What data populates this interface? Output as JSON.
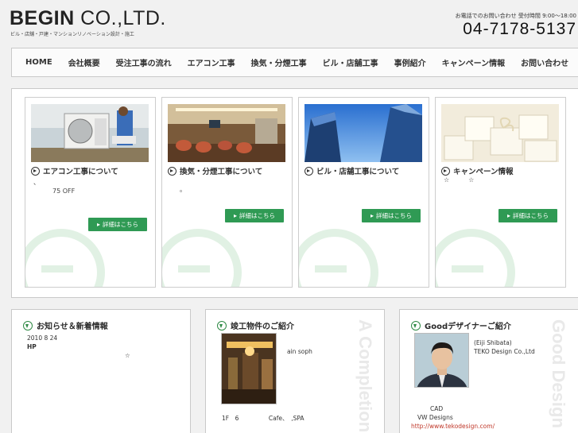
{
  "header": {
    "logo_bold": "BEGIN",
    "logo_rest": " CO.,LTD.",
    "tagline": "ビル・店舗・戸建・マンションリノベーション設計・施工",
    "tel_label": "お電話でのお問い合わせ 受付時間 9:00〜18:00",
    "tel": "04-7178-5137"
  },
  "nav": {
    "items": [
      "HOME",
      "会社概要",
      "受注工事の流れ",
      "エアコン工事",
      "換気・分煙工事",
      "ビル・店舗工事",
      "事例紹介",
      "キャンペーン情報",
      "お問い合わせ"
    ]
  },
  "cards": [
    {
      "title": "エアコン工事について",
      "text1": "、",
      "text2": "75 OFF",
      "button": "詳細はこちら"
    },
    {
      "title": "換気・分煙工事について",
      "text1": "。",
      "text2": "",
      "button": "詳細はこちら"
    },
    {
      "title": "ビル・店舗工事について",
      "text1": "",
      "text2": "",
      "button": "詳細はこちら"
    },
    {
      "title": "キャンペーン情報",
      "text1": "☆　　　☆",
      "text2": "",
      "button": "詳細はこちら"
    }
  ],
  "news": {
    "title": "お知らせ＆新着情報",
    "date": "2010 8 24",
    "hp": "HP",
    "star": "☆"
  },
  "completion": {
    "title": "竣工物件のご紹介",
    "name": "ain soph",
    "detail": "1F　6　　　　　Cafe、　,SPA",
    "deco": "A Completion"
  },
  "designer": {
    "title": "Goodデザイナーご紹介",
    "name": "(Eiji Shibata)",
    "company": "TEKO Design Co.,Ltd",
    "cad": "CAD",
    "vw": "VW Designs",
    "url": "http://www.tekodesign.com/",
    "deco": "Good Design"
  }
}
